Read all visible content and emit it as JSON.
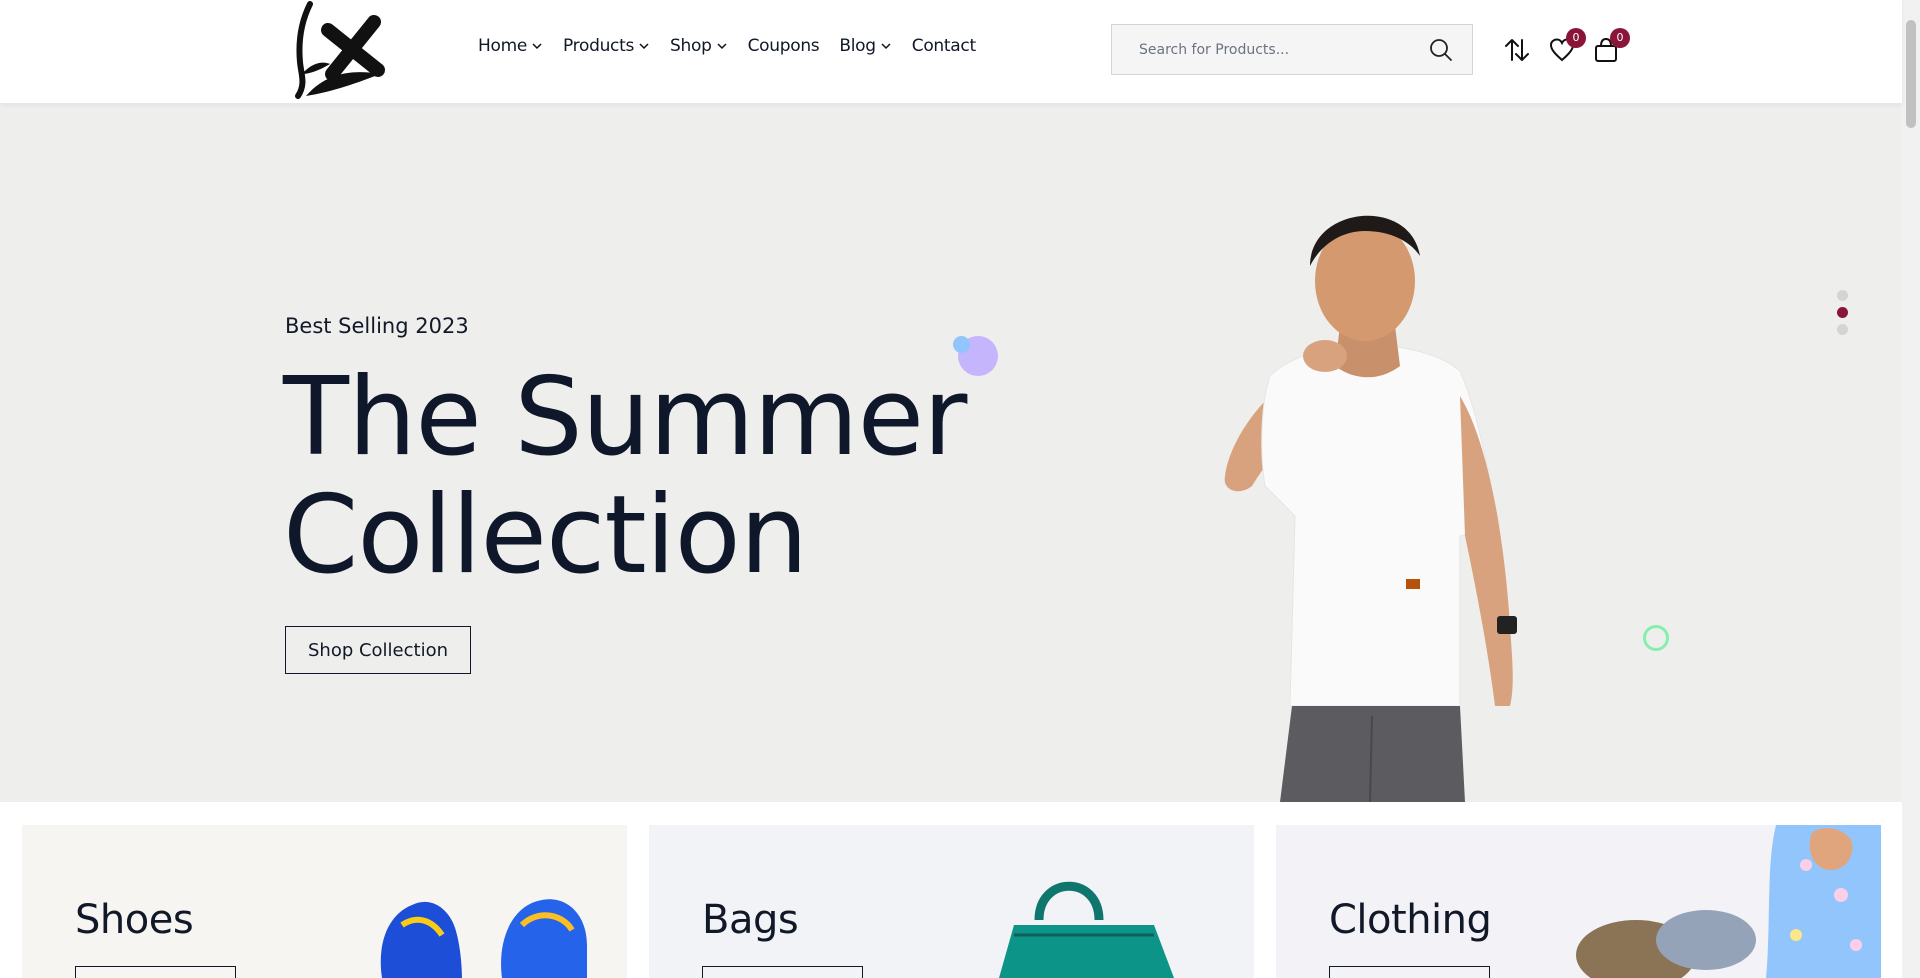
{
  "header": {
    "nav": [
      {
        "label": "Home",
        "has_dropdown": true
      },
      {
        "label": "Products",
        "has_dropdown": true
      },
      {
        "label": "Shop",
        "has_dropdown": true
      },
      {
        "label": "Coupons",
        "has_dropdown": false
      },
      {
        "label": "Blog",
        "has_dropdown": true
      },
      {
        "label": "Contact",
        "has_dropdown": false
      }
    ],
    "search": {
      "placeholder": "Search for Products..."
    },
    "icons": {
      "compare": "compare-arrows-icon",
      "wishlist": "heart-icon",
      "cart": "shopping-bag-icon"
    },
    "wishlist_count": "0",
    "cart_count": "0"
  },
  "hero": {
    "eyebrow": "Best Selling 2023",
    "title_line1": "The Summer",
    "title_line2": "Collection",
    "cta_label": "Shop Collection",
    "slide_count": 3,
    "active_slide": 2
  },
  "categories": [
    {
      "title": "Shoes",
      "background": "#f7f5f2"
    },
    {
      "title": "Bags",
      "background": "#f2f3f7"
    },
    {
      "title": "Clothing",
      "background": "#f3f3f7"
    }
  ],
  "colors": {
    "accent": "#8a1538",
    "hero_bg": "#eeeeec",
    "text_dark": "#0f172a"
  }
}
